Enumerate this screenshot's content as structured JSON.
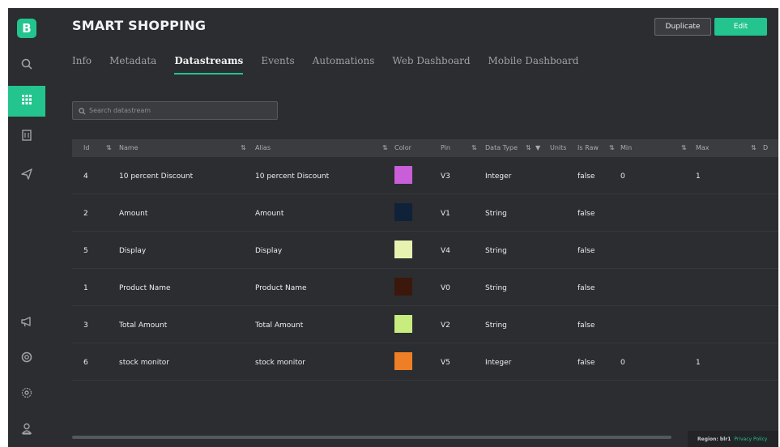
{
  "app": {
    "logo_letter": "B"
  },
  "sidebar": {
    "items": [
      {
        "name": "search-icon",
        "active": false
      },
      {
        "name": "grid-icon",
        "active": true
      },
      {
        "name": "building-icon",
        "active": false
      },
      {
        "name": "send-icon",
        "active": false
      },
      {
        "name": "megaphone-icon",
        "active": false
      },
      {
        "name": "help-icon",
        "active": false
      },
      {
        "name": "settings-icon",
        "active": false
      },
      {
        "name": "user-icon",
        "active": false
      }
    ]
  },
  "header": {
    "title": "SMART SHOPPING",
    "duplicate_label": "Duplicate",
    "edit_label": "Edit"
  },
  "tabs": [
    {
      "label": "Info",
      "active": false
    },
    {
      "label": "Metadata",
      "active": false
    },
    {
      "label": "Datastreams",
      "active": true
    },
    {
      "label": "Events",
      "active": false
    },
    {
      "label": "Automations",
      "active": false
    },
    {
      "label": "Web Dashboard",
      "active": false
    },
    {
      "label": "Mobile Dashboard",
      "active": false
    }
  ],
  "search": {
    "placeholder": "Search datastream"
  },
  "table": {
    "columns": {
      "id": "Id",
      "name": "Name",
      "alias": "Alias",
      "color": "Color",
      "pin": "Pin",
      "data_type": "Data Type",
      "units": "Units",
      "is_raw": "Is Raw",
      "min": "Min",
      "max": "Max",
      "extra": "D"
    },
    "rows": [
      {
        "id": "4",
        "name": "10 percent Discount",
        "alias": "10 percent Discount",
        "color": "#c95fd8",
        "pin": "V3",
        "data_type": "Integer",
        "is_raw": "false",
        "min": "0",
        "max": "1"
      },
      {
        "id": "2",
        "name": "Amount",
        "alias": "Amount",
        "color": "#10223a",
        "pin": "V1",
        "data_type": "String",
        "is_raw": "false",
        "min": "",
        "max": ""
      },
      {
        "id": "5",
        "name": "Display",
        "alias": "Display",
        "color": "#e8f2b0",
        "pin": "V4",
        "data_type": "String",
        "is_raw": "false",
        "min": "",
        "max": ""
      },
      {
        "id": "1",
        "name": "Product Name",
        "alias": "Product Name",
        "color": "#3c170c",
        "pin": "V0",
        "data_type": "String",
        "is_raw": "false",
        "min": "",
        "max": ""
      },
      {
        "id": "3",
        "name": "Total Amount",
        "alias": "Total Amount",
        "color": "#c9ec7e",
        "pin": "V2",
        "data_type": "String",
        "is_raw": "false",
        "min": "",
        "max": ""
      },
      {
        "id": "6",
        "name": "stock monitor",
        "alias": "stock monitor",
        "color": "#ef7f26",
        "pin": "V5",
        "data_type": "Integer",
        "is_raw": "false",
        "min": "0",
        "max": "1"
      }
    ]
  },
  "footer": {
    "region": "Region: blr1",
    "privacy": "Privacy Policy"
  },
  "colors": {
    "accent": "#23c48e",
    "background": "#2b2d30",
    "header_row": "#3a3c40"
  }
}
